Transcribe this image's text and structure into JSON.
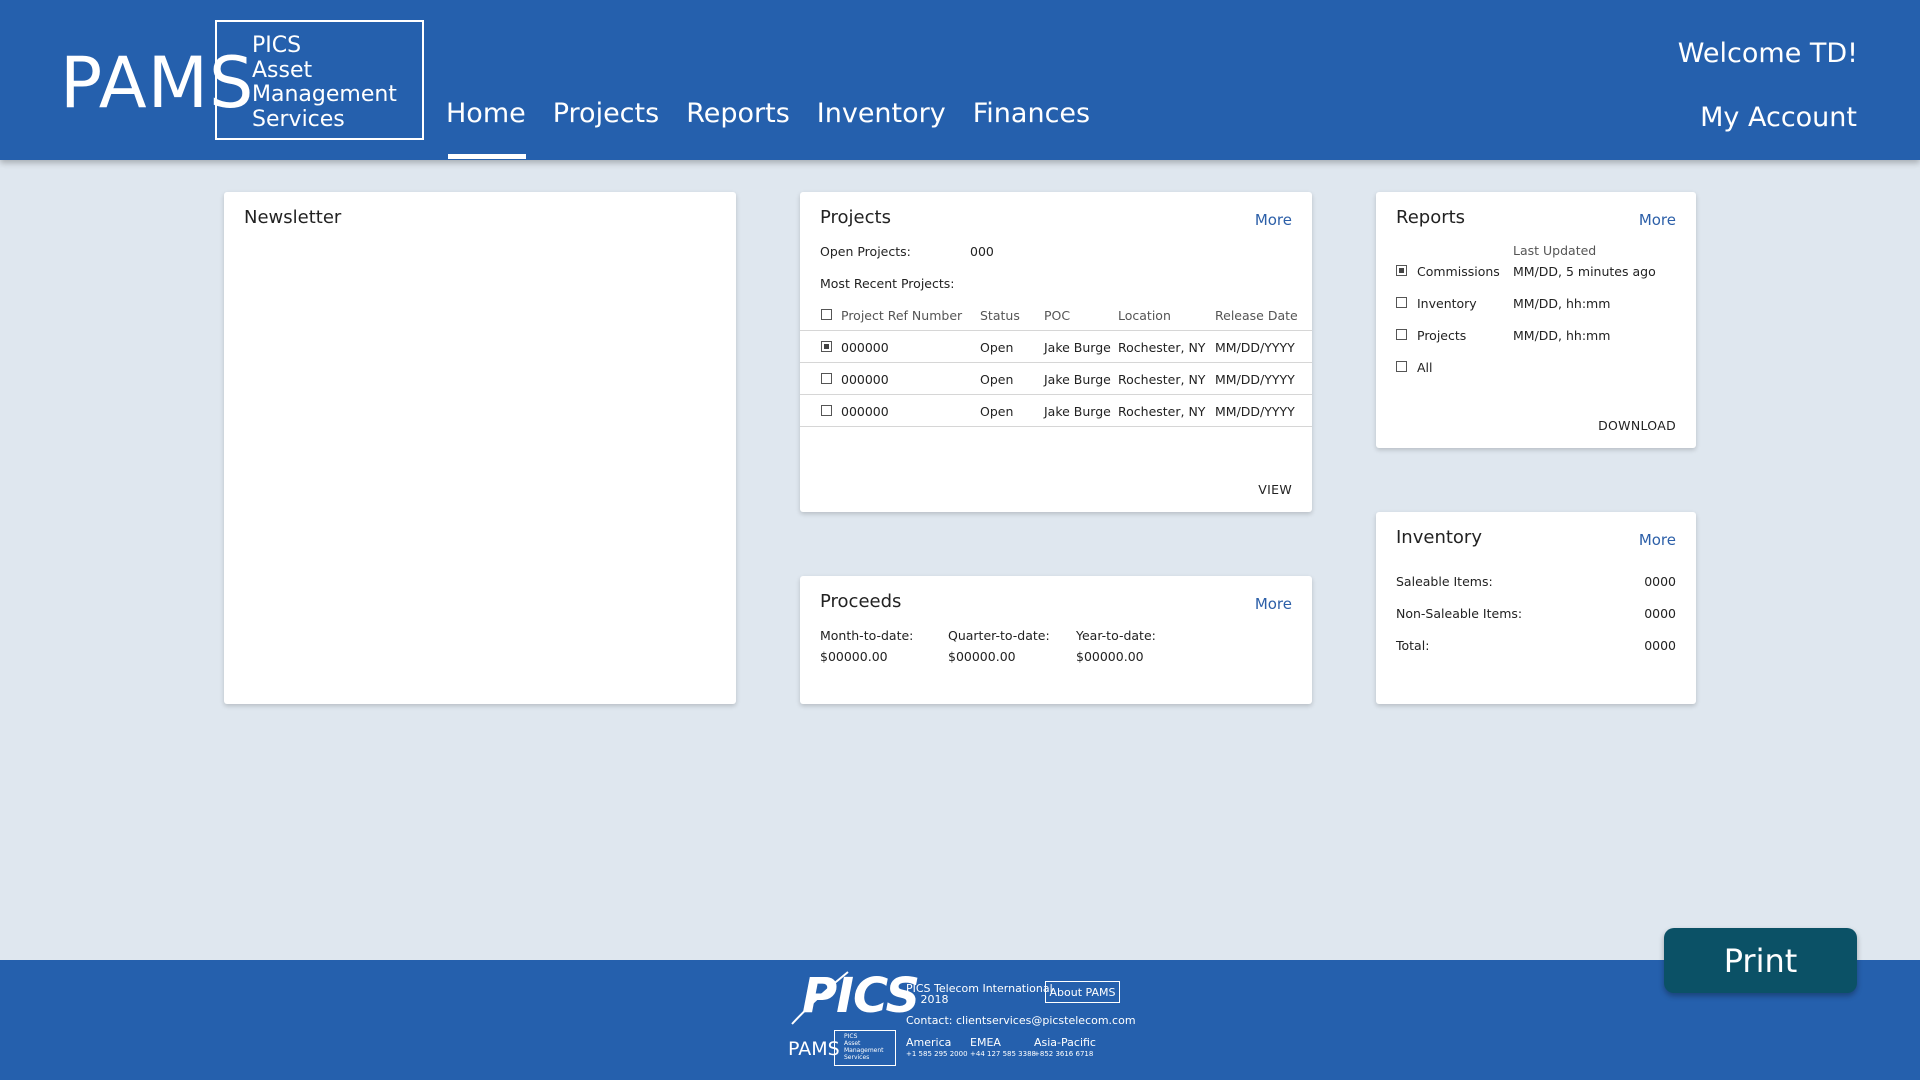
{
  "header": {
    "brand": "PAMS",
    "brand_box_lines": [
      "PICS",
      "Asset",
      "Management",
      "Services"
    ],
    "nav": [
      {
        "label": "Home",
        "active": true
      },
      {
        "label": "Projects",
        "active": false
      },
      {
        "label": "Reports",
        "active": false
      },
      {
        "label": "Inventory",
        "active": false
      },
      {
        "label": "Finances",
        "active": false
      }
    ],
    "welcome": "Welcome TD!",
    "my_account": "My Account"
  },
  "newsletter": {
    "title": "Newsletter"
  },
  "projects": {
    "title": "Projects",
    "more": "More",
    "open_label": "Open Projects:",
    "open_value": "000",
    "recent_label": "Most Recent Projects:",
    "columns": [
      "Project Ref Number",
      "Status",
      "POC",
      "Location",
      "Release Date"
    ],
    "rows": [
      {
        "checked": true,
        "ref": "000000",
        "status": "Open",
        "poc": "Jake Burge",
        "location": "Rochester, NY",
        "date": "MM/DD/YYYY"
      },
      {
        "checked": false,
        "ref": "000000",
        "status": "Open",
        "poc": "Jake Burge",
        "location": "Rochester, NY",
        "date": "MM/DD/YYYY"
      },
      {
        "checked": false,
        "ref": "000000",
        "status": "Open",
        "poc": "Jake Burge",
        "location": "Rochester, NY",
        "date": "MM/DD/YYYY"
      }
    ],
    "view": "VIEW"
  },
  "proceeds": {
    "title": "Proceeds",
    "more": "More",
    "items": [
      {
        "label": "Month-to-date:",
        "value": "$00000.00"
      },
      {
        "label": "Quarter-to-date:",
        "value": "$00000.00"
      },
      {
        "label": "Year-to-date:",
        "value": "$00000.00"
      }
    ]
  },
  "reports": {
    "title": "Reports",
    "more": "More",
    "last_updated_header": "Last Updated",
    "items": [
      {
        "checked": true,
        "label": "Commissions",
        "updated": "MM/DD, 5 minutes ago"
      },
      {
        "checked": false,
        "label": "Inventory",
        "updated": "MM/DD, hh:mm"
      },
      {
        "checked": false,
        "label": "Projects",
        "updated": "MM/DD, hh:mm"
      },
      {
        "checked": false,
        "label": "All",
        "updated": ""
      }
    ],
    "download": "DOWNLOAD"
  },
  "inventory": {
    "title": "Inventory",
    "more": "More",
    "items": [
      {
        "label": "Saleable Items:",
        "value": "0000"
      },
      {
        "label": "Non-Saleable Items:",
        "value": "0000"
      },
      {
        "label": "Total:",
        "value": "0000"
      }
    ]
  },
  "print_button": "Print",
  "footer": {
    "logo_text": "PICS",
    "company": "PICS Telecom International",
    "copyright": "© 2018",
    "about": "About PAMS",
    "contact": "Contact: clientservices@picstelecom.com",
    "pams_text": "PAMS",
    "pams_box_lines": [
      "PICS",
      "Asset",
      "Management",
      "Services"
    ],
    "regions": [
      {
        "name": "America",
        "phone": "+1 585 295 2000"
      },
      {
        "name": "EMEA",
        "phone": "+44 127 585 3388"
      },
      {
        "name": "Asia-Pacific",
        "phone": "+852 3616 6718"
      }
    ]
  },
  "colors": {
    "header_bg": "#2560ad",
    "page_bg": "#dfe7ef",
    "print_bg": "#0b5166",
    "link": "#2c5fa8"
  }
}
